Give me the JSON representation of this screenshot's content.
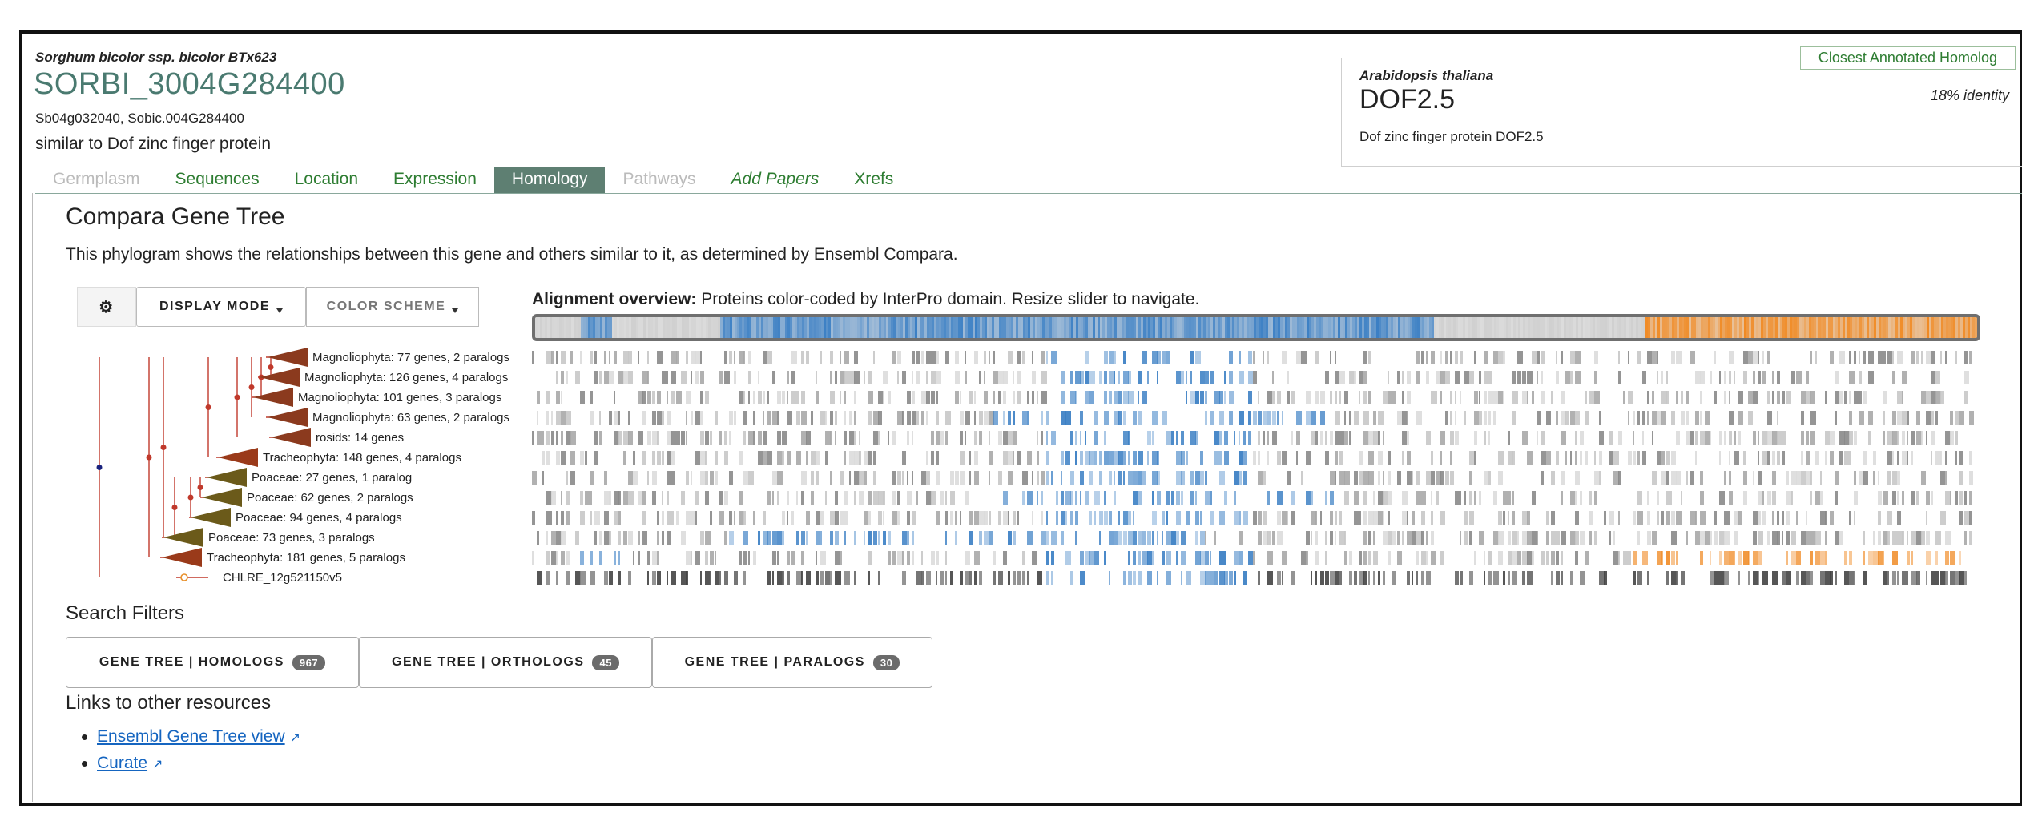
{
  "gene": {
    "species": "Sorghum bicolor ssp. bicolor BTx623",
    "id": "SORBI_3004G284400",
    "synonyms": "Sb04g032040, Sobic.004G284400",
    "description": "similar to Dof zinc finger protein"
  },
  "homolog": {
    "tag": "Closest Annotated Homolog",
    "species": "Arabidopsis thaliana",
    "name": "DOF2.5",
    "identity": "18% identity",
    "description": "Dof zinc finger protein DOF2.5"
  },
  "tabs": [
    {
      "label": "Germplasm",
      "state": "disabled"
    },
    {
      "label": "Sequences",
      "state": "normal"
    },
    {
      "label": "Location",
      "state": "normal"
    },
    {
      "label": "Expression",
      "state": "normal"
    },
    {
      "label": "Homology",
      "state": "active"
    },
    {
      "label": "Pathways",
      "state": "disabled"
    },
    {
      "label": "Add Papers",
      "state": "italic"
    },
    {
      "label": "Xrefs",
      "state": "normal"
    }
  ],
  "section": {
    "title": "Compara Gene Tree",
    "intro": "This phylogram shows the relationships between this gene and others similar to it, as determined by Ensembl Compara."
  },
  "controls": {
    "gear_icon": "gear-icon",
    "display_mode": "DISPLAY MODE",
    "color_scheme": "COLOR SCHEME"
  },
  "alignment": {
    "label_bold": "Alignment overview:",
    "label_rest": "Proteins color-coded by InterPro domain. Resize slider to navigate."
  },
  "tree_nodes": [
    {
      "label": "Magnoliophyta: 77 genes, 2 paralogs",
      "color": "#8b3a1e"
    },
    {
      "label": "Magnoliophyta: 126 genes, 4 paralogs",
      "color": "#8b3a1e"
    },
    {
      "label": "Magnoliophyta: 101 genes, 3 paralogs",
      "color": "#8b3a1e"
    },
    {
      "label": "Magnoliophyta: 63 genes, 2 paralogs",
      "color": "#8b3a1e"
    },
    {
      "label": "rosids: 14 genes",
      "color": "#8b3a1e"
    },
    {
      "label": "Tracheophyta: 148 genes, 4 paralogs",
      "color": "#9a3a1a"
    },
    {
      "label": "Poaceae: 27 genes, 1 paralog",
      "color": "#6b5a1a"
    },
    {
      "label": "Poaceae: 62 genes, 2 paralogs",
      "color": "#6b5a1a"
    },
    {
      "label": "Poaceae: 94 genes, 4 paralogs",
      "color": "#6b5a1a"
    },
    {
      "label": "Poaceae: 73 genes, 3 paralogs",
      "color": "#6b5a1a"
    },
    {
      "label": "Tracheophyta: 181 genes, 5 paralogs",
      "color": "#9a3a1a"
    },
    {
      "label": "CHLRE_12g521150v5",
      "color": "#e8902a"
    }
  ],
  "search_filters": {
    "title": "Search Filters",
    "buttons": [
      {
        "label": "GENE TREE | HOMOLOGS",
        "count": "967"
      },
      {
        "label": "GENE TREE | ORTHOLOGS",
        "count": "45"
      },
      {
        "label": "GENE TREE | PARALOGS",
        "count": "30"
      }
    ]
  },
  "links": {
    "title": "Links to other resources",
    "items": [
      {
        "label": "Ensembl Gene Tree view"
      },
      {
        "label": "Curate"
      }
    ]
  },
  "colors": {
    "accent": "#2e7d32",
    "tab_active": "#5e7f72",
    "domain_blue": "#3b7fc4",
    "domain_orange": "#f08a24",
    "gap_grey": "#9a9a9a"
  }
}
